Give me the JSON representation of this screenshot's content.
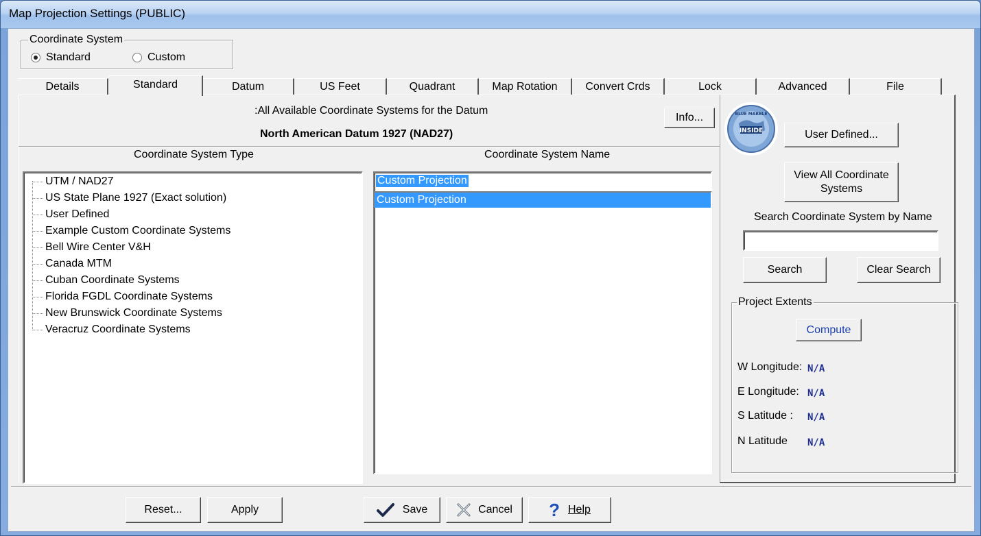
{
  "window": {
    "title": "Map Projection Settings (PUBLIC)"
  },
  "coordinate_system": {
    "legend": "Coordinate System",
    "options": [
      {
        "label": "Standard",
        "checked": true
      },
      {
        "label": "Custom",
        "checked": false
      }
    ]
  },
  "tabs": [
    "Details",
    "Standard",
    "Datum",
    "US Feet",
    "Quadrant",
    "Map Rotation",
    "Convert Crds",
    "Lock",
    "Advanced",
    "File"
  ],
  "active_tab": "Standard",
  "main": {
    "available_label": ":All Available Coordinate Systems for the Datum",
    "info_button": "Info...",
    "datum_name": "North American Datum 1927 (NAD27)",
    "type_header": "Coordinate System Type",
    "name_header": "Coordinate System Name",
    "tree_items": [
      "UTM / NAD27",
      "US State Plane 1927 (Exact solution)",
      "User Defined",
      "Example Custom Coordinate Systems",
      "Bell Wire Center V&H",
      "Canada MTM",
      "Cuban Coordinate Systems",
      "Florida FGDL Coordinate Systems",
      "New Brunswick Coordinate Systems",
      "Veracruz Coordinate Systems"
    ],
    "name_input_value": "Custom Projection",
    "name_list": [
      "Custom Projection"
    ]
  },
  "side": {
    "logo_text": "BLUE MARBLE INSIDE",
    "user_defined_button": "User Defined...",
    "view_all_button_line1": "View All Coordinate",
    "view_all_button_line2": "Systems",
    "search_label": "Search Coordinate System by Name",
    "search_value": "",
    "search_button": "Search",
    "clear_search_button": "Clear Search",
    "extents": {
      "legend": "Project Extents",
      "compute_button": "Compute",
      "rows": [
        {
          "label": "W Longitude:",
          "value": "N/A"
        },
        {
          "label": "E Longitude:",
          "value": "N/A"
        },
        {
          "label": "S Latitude :",
          "value": "N/A"
        },
        {
          "label": "N Latitude",
          "value": "N/A"
        }
      ]
    }
  },
  "footer": {
    "reset": "Reset...",
    "apply": "Apply",
    "save": "Save",
    "cancel": "Cancel",
    "help": "Help"
  },
  "colors": {
    "selection": "#3399ff",
    "title_gradient_top": "#dceaf9",
    "extent_value": "#1f2f8f"
  }
}
